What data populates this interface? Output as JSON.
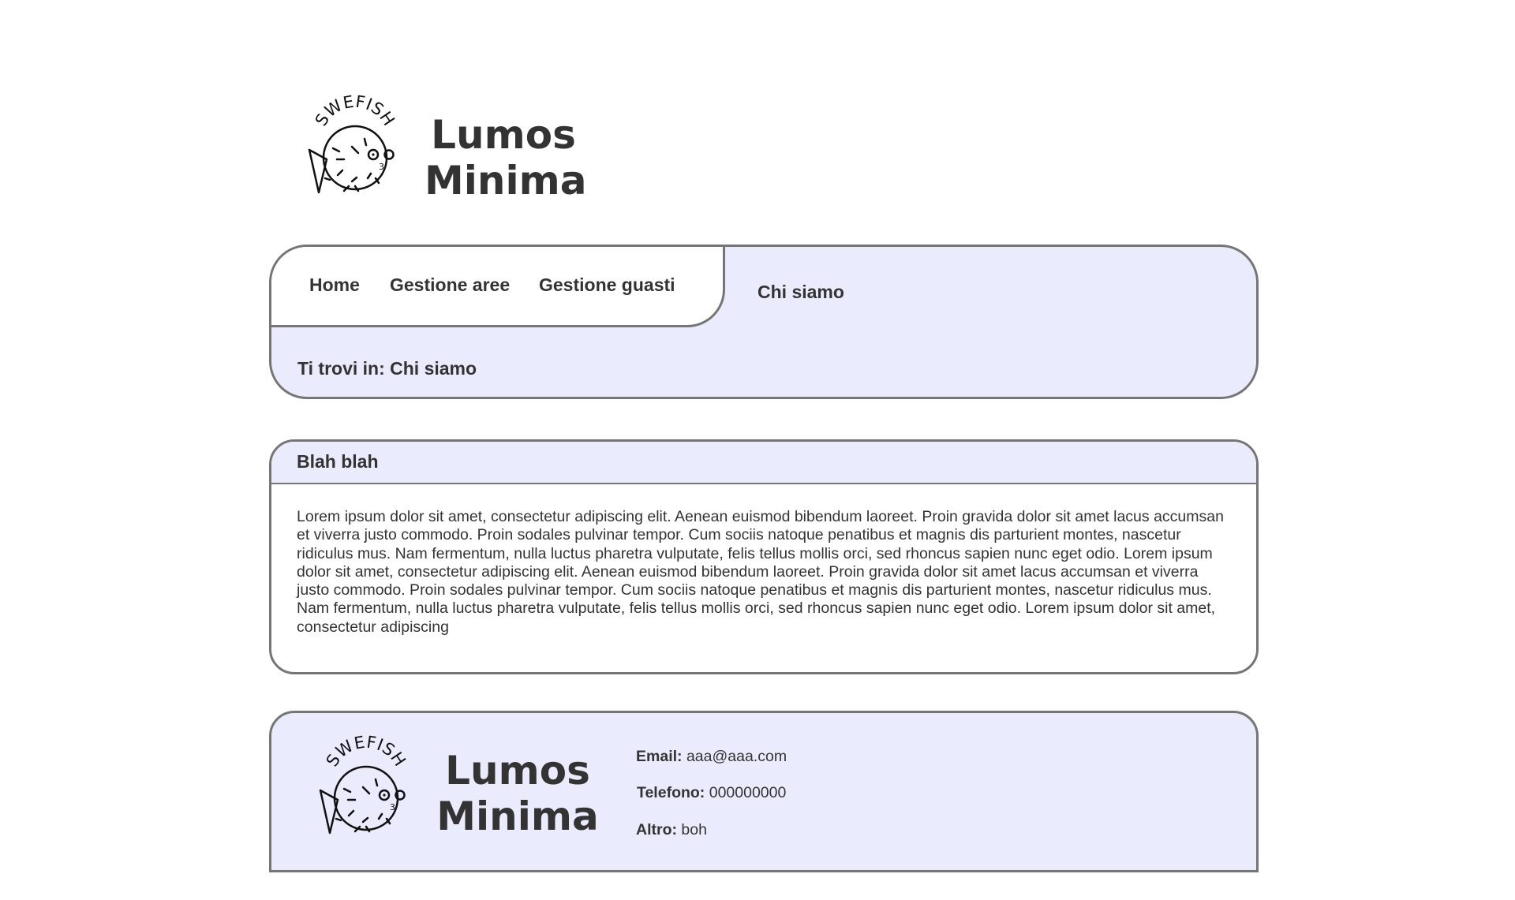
{
  "header": {
    "logo_text": "SWEFISH",
    "brand_line1": "Lumos",
    "brand_line2": "Minima"
  },
  "nav": {
    "links": [
      {
        "label": "Home"
      },
      {
        "label": "Gestione aree"
      },
      {
        "label": "Gestione guasti"
      }
    ],
    "current_page": "Chi siamo",
    "breadcrumb": "Ti trovi in: Chi siamo"
  },
  "content": {
    "title": "Blah blah",
    "body": "Lorem ipsum dolor sit amet, consectetur adipiscing elit. Aenean euismod bibendum laoreet. Proin gravida dolor sit amet lacus accumsan et viverra justo commodo. Proin sodales pulvinar tempor. Cum sociis natoque penatibus et magnis dis parturient montes, nascetur ridiculus mus. Nam fermentum, nulla luctus pharetra vulputate, felis tellus mollis orci, sed rhoncus sapien nunc eget odio. Lorem ipsum dolor sit amet, consectetur adipiscing elit. Aenean euismod bibendum laoreet. Proin gravida dolor sit amet lacus accumsan et viverra justo commodo. Proin sodales pulvinar tempor. Cum sociis natoque penatibus et magnis dis parturient montes, nascetur ridiculus mus. Nam fermentum, nulla luctus pharetra vulputate, felis tellus mollis orci, sed rhoncus sapien nunc eget odio. Lorem ipsum dolor sit amet, consectetur adipiscing"
  },
  "footer": {
    "logo_text": "SWEFISH",
    "brand_line1": "Lumos",
    "brand_line2": "Minima",
    "email_label": "Email:",
    "email_value": "aaa@aaa.com",
    "phone_label": "Telefono:",
    "phone_value": "000000000",
    "other_label": "Altro:",
    "other_value": "boh"
  },
  "colors": {
    "panel_fill": "#ebebfe",
    "panel_border": "#757575",
    "text": "#333333"
  }
}
